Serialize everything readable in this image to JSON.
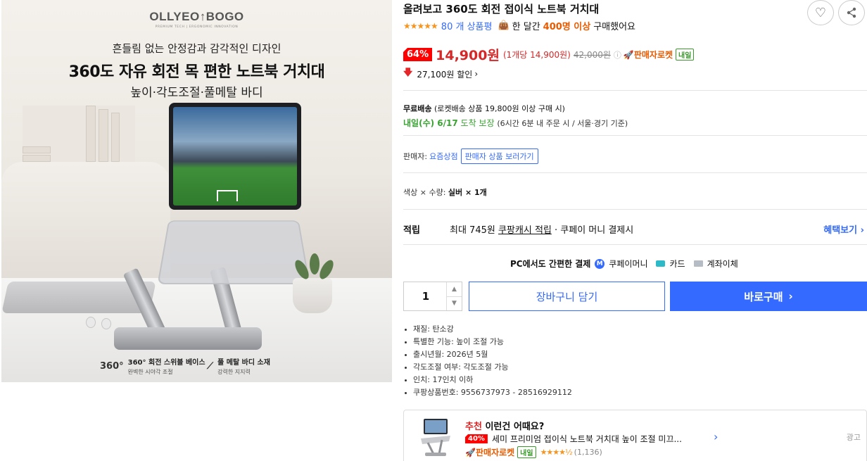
{
  "image": {
    "brand_name": "OLLYEO↑BOGO",
    "brand_sub": "PREMIUM TECH | ERGONOMIC INNOVATION",
    "tagline": "흔들림 없는 안정감과 감각적인 디자인",
    "headline": "360도 자유 회전 목 편한 노트북 거치대",
    "subline": "높이·각도조절·풀메탈 바디",
    "features": [
      {
        "icon": "360°",
        "title": "360° 회전 스위블 베이스",
        "desc": "완벽한 시야각 조절"
      },
      {
        "icon": "⟋",
        "title": "풀 메탈 바디 소재",
        "desc": "강력한 지지력"
      }
    ]
  },
  "product": {
    "title": "올려보고 360도 회전 접이식 노트북 거치대",
    "stars": "★★★★★",
    "review_count": "80 개 상품평",
    "monthly_prefix": "한 달간",
    "monthly_count": "400명 이상",
    "monthly_suffix": "구매했어요"
  },
  "price": {
    "discount": "64%",
    "sale": "14,900원",
    "unit": "(1개당 14,900원)",
    "original": "42,000원",
    "rocket": "판매자로켓",
    "tomorrow": "내일",
    "saving": "27,100원 할인",
    "saving_arrow": "›"
  },
  "shipping": {
    "free_label": "무료배송",
    "free_note": "(로켓배송 상품 19,800원 이상 구매 시)",
    "arrival_day": "내일(수) 6/17",
    "arrival_guarantee": "도착 보장",
    "arrival_note": "(6시간 6분 내 주문 시 / 서울·경기 기준)"
  },
  "seller": {
    "label": "판매자:",
    "name": "요즘상점",
    "button": "판매자 상품 보러가기"
  },
  "option": {
    "label": "색상 × 수량:",
    "value": "실버 × 1개"
  },
  "reward": {
    "label": "적립",
    "prefix": "최대 745원",
    "cash": "쿠팡캐시 적립",
    "suffix": "· 쿠페이 머니 결제시",
    "more": "혜택보기 ›"
  },
  "payment": {
    "pc_label": "PC에서도 간편한 결제",
    "m_icon": "M",
    "money": "쿠페이머니",
    "card": "카드",
    "bank": "계좌이체"
  },
  "purchase": {
    "quantity": "1",
    "cart": "장바구니 담기",
    "buy": "바로구매",
    "buy_arrow": "›"
  },
  "specs": [
    "재질: 탄소강",
    "특별한 기능: 높이 조절 가능",
    "출시년월: 2026년 5월",
    "각도조절 여부: 각도조절 가능",
    "인치: 17인치 이하",
    "쿠팡상품번호: 9556737973 - 28516929112"
  ],
  "recommend": {
    "title_red": "추천",
    "title_rest": "이런건 어때요?",
    "discount": "40%",
    "name": "세미 프리미엄 접이식 노트북 거치대 높이 조절 미끄...",
    "rocket": "판매자로켓",
    "tomorrow": "내일",
    "stars": "★★★★½",
    "count": "(1,136)",
    "ad": "광고",
    "arrow": "›"
  },
  "colors": {
    "accent_blue": "#346aff",
    "price_red": "#d62828",
    "discount_red": "#ff0000",
    "rocket_orange": "#e85b00",
    "delivery_green": "#39a332"
  }
}
